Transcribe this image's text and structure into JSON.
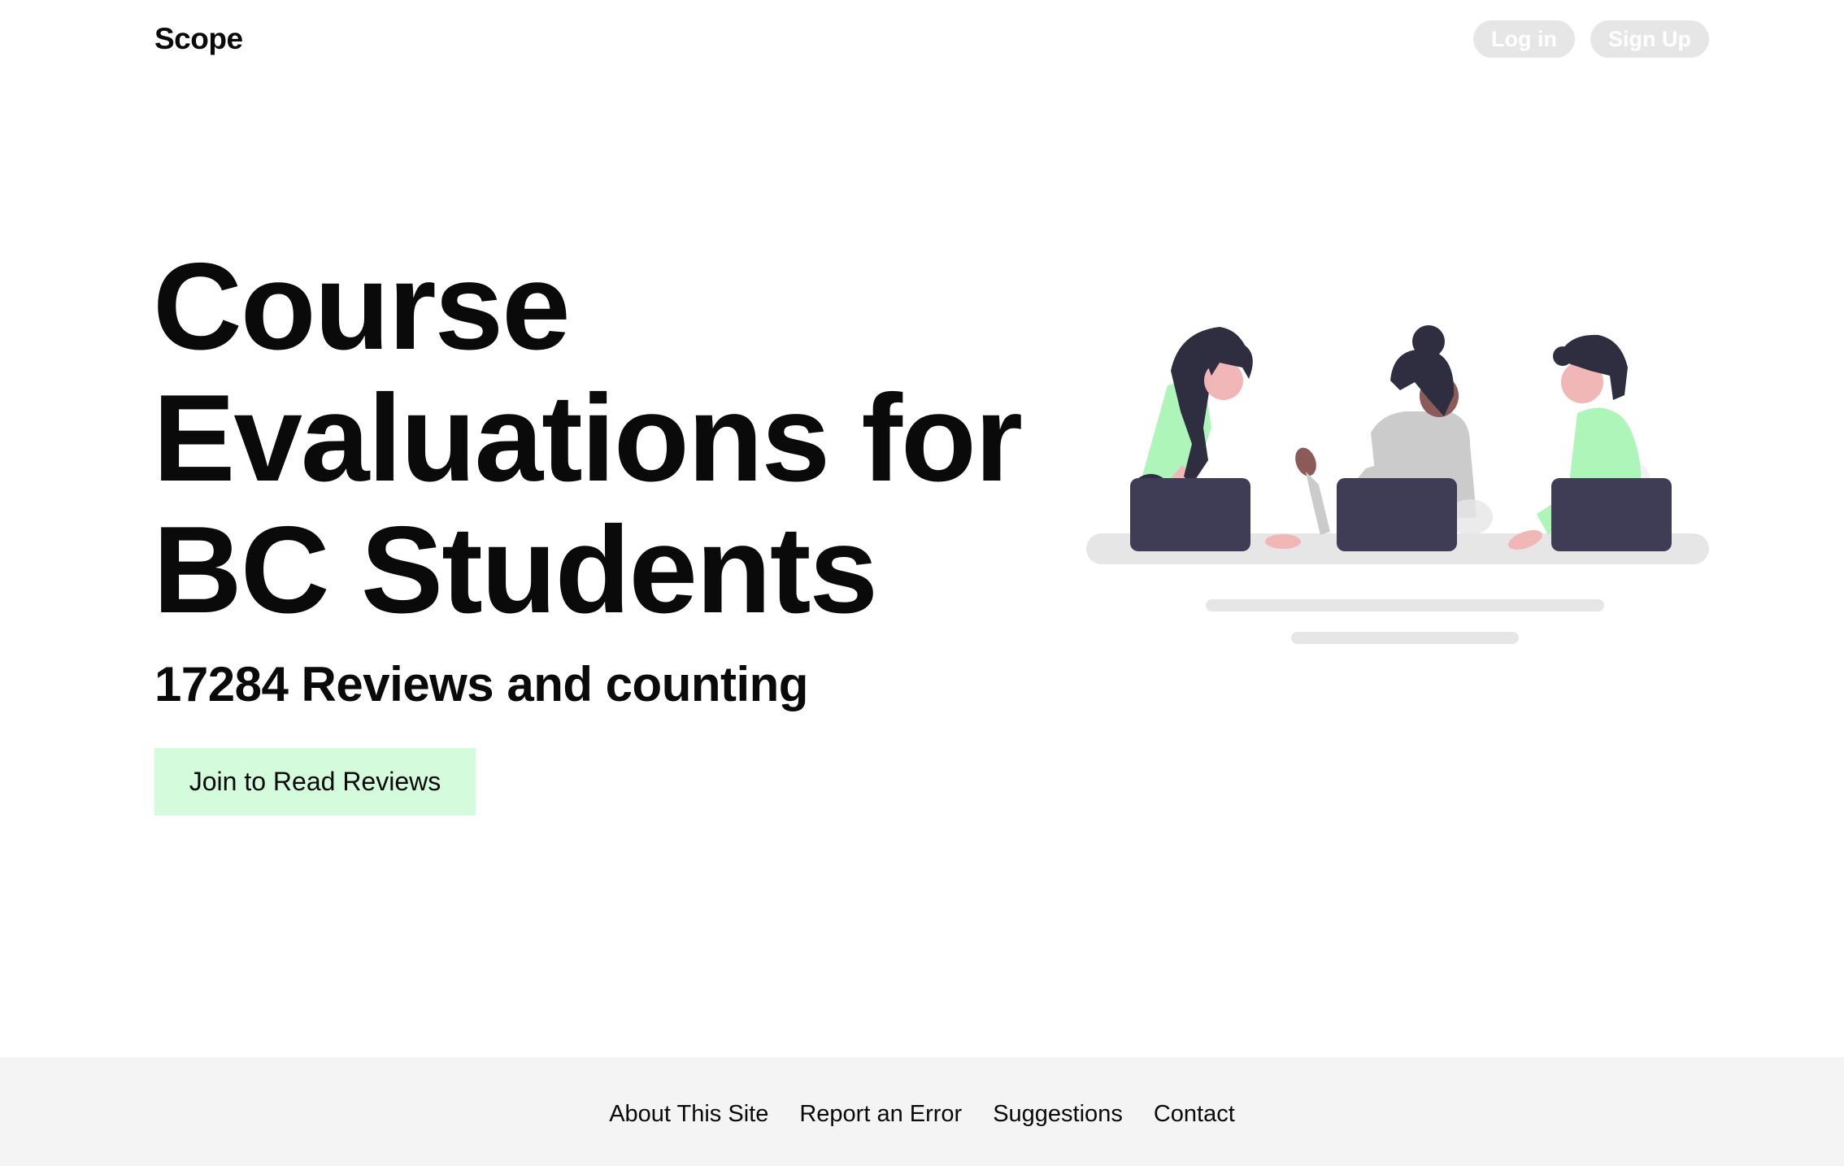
{
  "header": {
    "brand": "Scope",
    "login_label": "Log in",
    "signup_label": "Sign Up"
  },
  "hero": {
    "title": "Course Evaluations for BC Students",
    "subtitle": "17284 Reviews and counting",
    "cta_label": "Join to Read Reviews"
  },
  "colors": {
    "accent_green": "#aef5ba",
    "cta_bg": "#d3fbdc",
    "laptop": "#3f3d56",
    "hair": "#2f2e41",
    "skin_light": "#f1b7b7",
    "skin_dark": "#8d5a5a",
    "gray_shirt": "#cbcbcb",
    "table": "#e6e6e6",
    "footer_bg": "#f4f4f4"
  },
  "footer": {
    "links": [
      "About This Site",
      "Report an Error",
      "Suggestions",
      "Contact"
    ]
  }
}
